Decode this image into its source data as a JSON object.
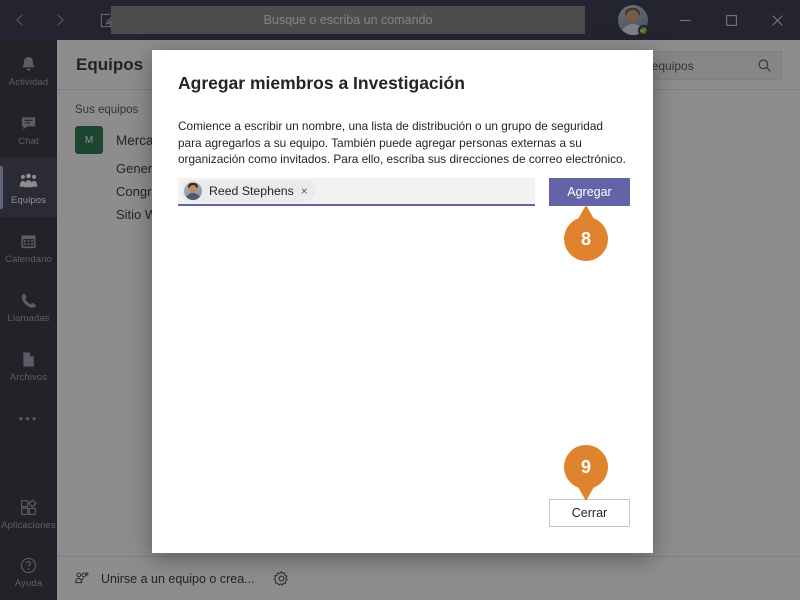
{
  "titlebar": {
    "back_icon": "chevron-left-icon",
    "forward_icon": "chevron-right-icon",
    "compose_icon": "compose-icon",
    "search_placeholder": "Busque o escriba un comando",
    "avatar_name": "user-avatar",
    "presence_status": "available",
    "minimize_label": "─",
    "maximize_label": "☐",
    "close_label": "✕"
  },
  "rail": {
    "items": [
      {
        "label": "Actividad",
        "icon": "bell-icon",
        "active": false
      },
      {
        "label": "Chat",
        "icon": "chat-icon",
        "active": false
      },
      {
        "label": "Equipos",
        "icon": "teams-icon",
        "active": true
      },
      {
        "label": "Calendario",
        "icon": "calendar-icon",
        "active": false
      },
      {
        "label": "Llamadas",
        "icon": "phone-icon",
        "active": false
      },
      {
        "label": "Archivos",
        "icon": "files-icon",
        "active": false
      }
    ],
    "more_label": "•••",
    "bottom_items": [
      {
        "label": "Aplicaciones",
        "icon": "apps-icon"
      },
      {
        "label": "Ayuda",
        "icon": "help-icon"
      }
    ]
  },
  "main": {
    "title": "Equipos",
    "search_value": "Buscar equipos",
    "search_icon": "search-icon",
    "section_label": "Sus equipos",
    "team": {
      "initial": "M",
      "name": "Mercadotecnia",
      "badge_color": "#136b3c"
    },
    "channels": [
      "General",
      "Congreso",
      "Sitio Web"
    ],
    "footer": {
      "join_label": "Unirse a un equipo o crea...",
      "join_icon": "join-team-icon",
      "gear_icon": "gear-icon"
    }
  },
  "dialog": {
    "title": "Agregar miembros a Investigación",
    "description": "Comience a escribir un nombre, una lista de distribución o un grupo de seguridad para agregarlos a su equipo. También puede agregar personas externas a su organización como invitados. Para ello, escriba sus direcciones de correo electrónico.",
    "chip": {
      "name": "Reed Stephens",
      "remove_icon": "×",
      "avatar_name": "reed-stephens-avatar"
    },
    "input_placeholder": "",
    "add_button": "Agregar",
    "close_button": "Cerrar"
  },
  "callouts": [
    {
      "number": "8",
      "direction": "up",
      "color": "#e0832f"
    },
    {
      "number": "9",
      "direction": "down",
      "color": "#e0832f"
    }
  ]
}
